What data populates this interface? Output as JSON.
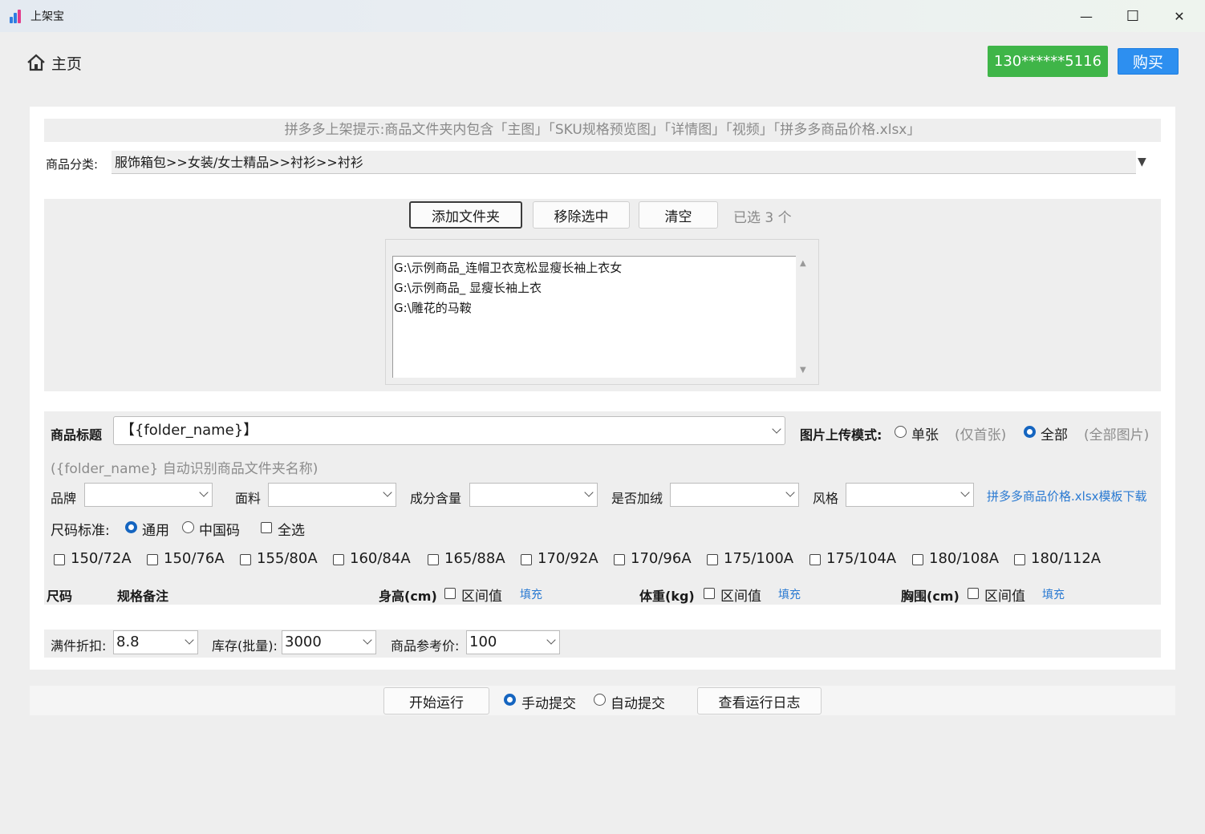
{
  "window": {
    "title": "上架宝",
    "minimize_glyph": "—",
    "maximize_glyph": "☐",
    "close_glyph": "✕"
  },
  "header": {
    "home_label": "主页",
    "account": "130******5116",
    "buy_label": "购买"
  },
  "hint": "拼多多上架提示:商品文件夹内包含「主图」「SKU规格预览图」「详情图」「视频」「拼多多商品价格.xlsx」",
  "category": {
    "label": "商品分类:",
    "value": "服饰箱包>>女装/女士精品>>衬衫>>衬衫",
    "arrow": "▼"
  },
  "folders": {
    "add_button": "添加文件夹",
    "remove_button": "移除选中",
    "clear_button": "清空",
    "selected_count": "已选 3 个",
    "items": [
      "G:\\示例商品_连帽卫衣宽松显瘦长袖上衣女",
      "G:\\示例商品_ 显瘦长袖上衣",
      "G:\\雕花的马鞍"
    ]
  },
  "product_title": {
    "label": "商品标题",
    "value": "【{folder_name}】",
    "hint": "({folder_name} 自动识别商品文件夹名称)"
  },
  "image_mode": {
    "label": "图片上传模式:",
    "options": [
      {
        "label": "单张",
        "note": "(仅首张)",
        "selected": false
      },
      {
        "label": "全部",
        "note": "(全部图片)",
        "selected": true
      }
    ]
  },
  "attributes": {
    "brand": {
      "label": "品牌",
      "value": ""
    },
    "fabric": {
      "label": "面料",
      "value": ""
    },
    "content": {
      "label": "成分含量",
      "value": ""
    },
    "fleece": {
      "label": "是否加绒",
      "value": ""
    },
    "style": {
      "label": "风格",
      "value": ""
    },
    "template_link": "拼多多商品价格.xlsx模板下载"
  },
  "size_standard": {
    "label": "尺码标准:",
    "options": [
      {
        "label": "通用",
        "selected": true
      },
      {
        "label": "中国码",
        "selected": false
      }
    ],
    "select_all": "全选"
  },
  "sizes": [
    "150/72A",
    "150/76A",
    "155/80A",
    "160/84A",
    "165/88A",
    "170/92A",
    "170/96A",
    "175/100A",
    "175/104A",
    "180/108A",
    "180/112A"
  ],
  "size_table": {
    "col_size": "尺码",
    "col_note": "规格备注",
    "height": {
      "label": "身高(cm)",
      "range": "区间值",
      "fill": "填充"
    },
    "weight": {
      "label": "体重(kg)",
      "range": "区间值",
      "fill": "填充"
    },
    "chest": {
      "label": "胸围(cm)",
      "range": "区间值",
      "fill": "填充"
    }
  },
  "bottom": {
    "discount": {
      "label": "满件折扣:",
      "value": "8.8"
    },
    "stock": {
      "label": "库存(批量):",
      "value": "3000"
    },
    "ref_price": {
      "label": "商品参考价:",
      "value": "100"
    }
  },
  "footer": {
    "start_button": "开始运行",
    "submit_modes": [
      {
        "label": "手动提交",
        "selected": true
      },
      {
        "label": "自动提交",
        "selected": false
      }
    ],
    "log_button": "查看运行日志"
  }
}
